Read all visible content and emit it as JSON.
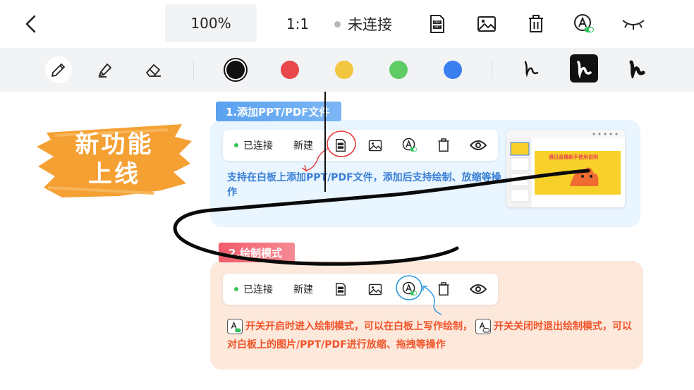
{
  "header": {
    "back_icon": "chevron-left-icon",
    "zoom": "100%",
    "ratio": "1:1",
    "connection_status": "未连接",
    "icons": [
      "ppt-pdf-icon",
      "image-icon",
      "trash-icon",
      "draw-mode-icon",
      "eye-closed-icon"
    ]
  },
  "toolbar": {
    "tools": [
      "pencil-icon",
      "highlighter-icon",
      "eraser-icon"
    ],
    "colors": [
      "#111111",
      "#e8484b",
      "#f2c63e",
      "#5fcb65",
      "#3a7ef0"
    ],
    "selected_color": "#111111",
    "stroke_sizes": [
      "thin",
      "medium",
      "thick"
    ],
    "selected_stroke": "medium"
  },
  "canvas": {
    "new_feature_badge": [
      "新功能",
      "上线"
    ],
    "section1": {
      "title": "1.添加PPT/PDF文件",
      "bar": {
        "status": "已连接",
        "new_label": "新建"
      },
      "description": "支持在白板上添加PPT/PDF文件，添加后支持绘制、放缩等操作"
    },
    "section2": {
      "title": "2.绘制模式",
      "bar": {
        "status": "已连接",
        "new_label": "新建"
      },
      "description_part1": "开关开启时进入绘制模式，可以在白板上写作绘制，",
      "description_part2": "开关关闭时退出绘制模式，可以对白板上的图片/PPT/PDF进行放缩、拖拽等操作"
    },
    "thumbnail_title": "遇见直播新手使用说明"
  }
}
